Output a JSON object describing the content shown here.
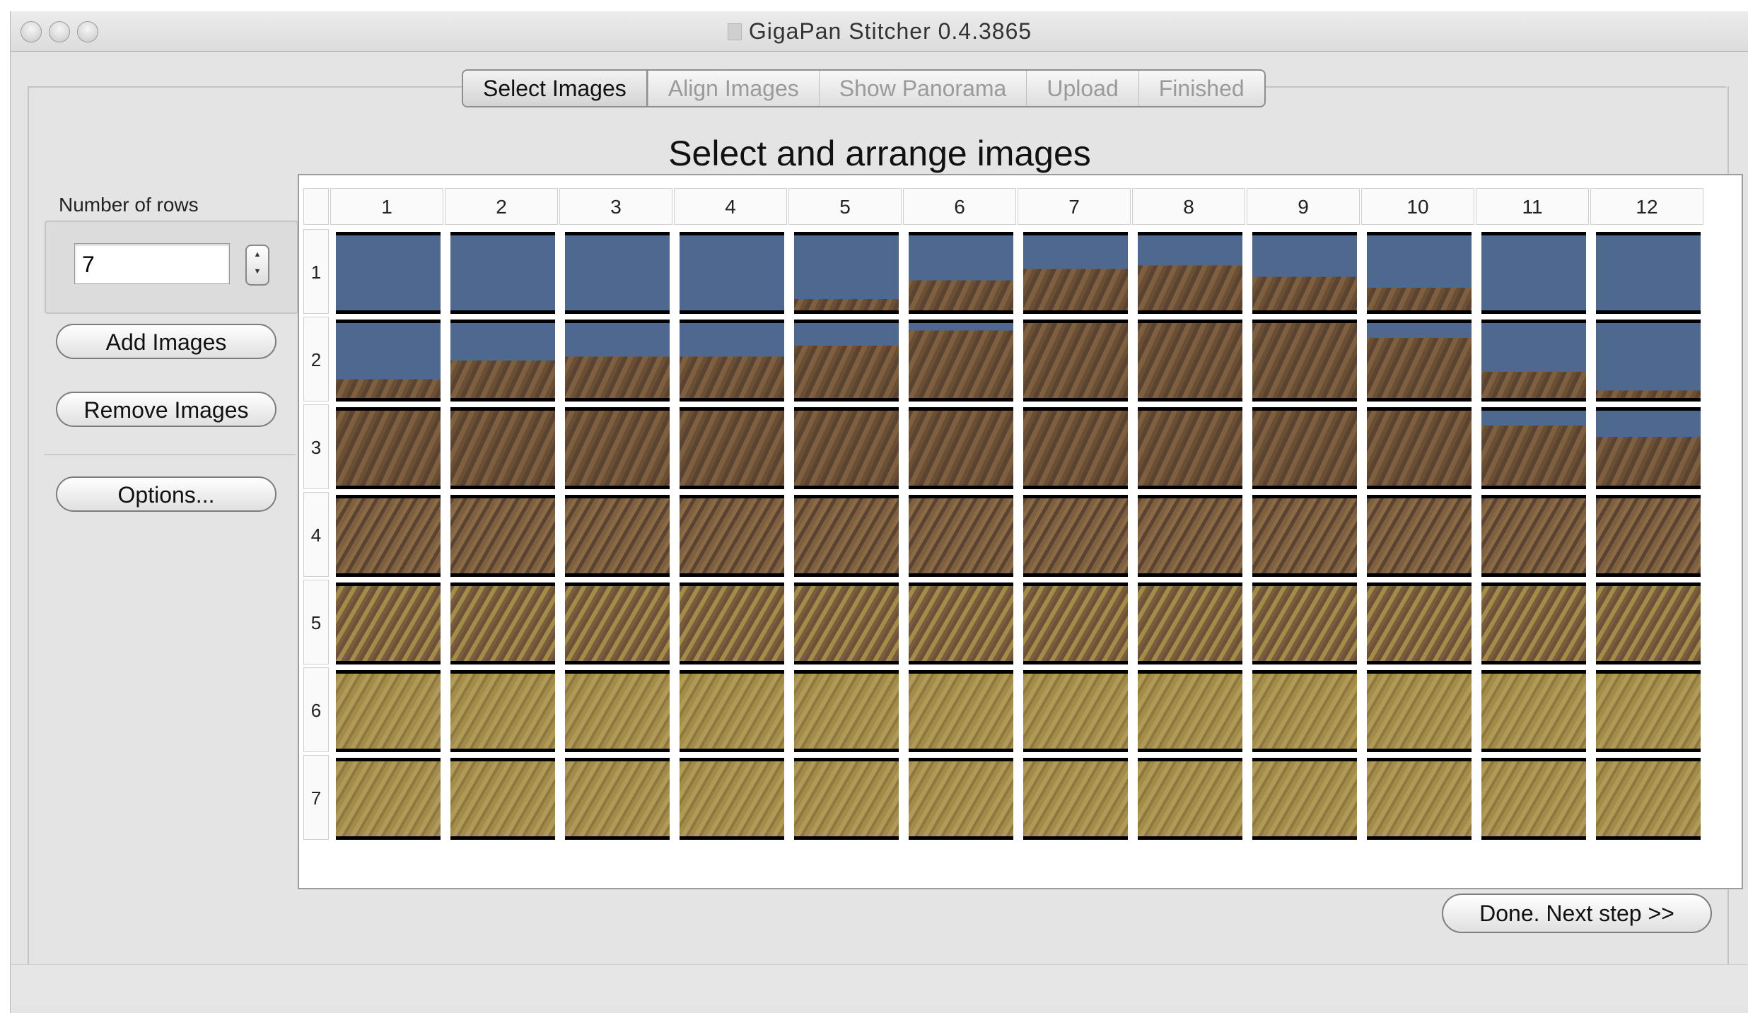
{
  "window": {
    "title": "GigaPan Stitcher 0.4.3865"
  },
  "tabs": [
    {
      "label": "Select Images",
      "active": true
    },
    {
      "label": "Align Images",
      "active": false
    },
    {
      "label": "Show Panorama",
      "active": false
    },
    {
      "label": "Upload",
      "active": false
    },
    {
      "label": "Finished",
      "active": false
    }
  ],
  "main": {
    "heading": "Select and arrange images"
  },
  "sidebar": {
    "rows_label": "Number of rows",
    "rows_value": "7",
    "add_images": "Add Images",
    "remove_images": "Remove Images",
    "options": "Options..."
  },
  "grid": {
    "columns": [
      "1",
      "2",
      "3",
      "4",
      "5",
      "6",
      "7",
      "8",
      "9",
      "10",
      "11",
      "12"
    ],
    "rows": [
      "1",
      "2",
      "3",
      "4",
      "5",
      "6",
      "7"
    ]
  },
  "footer": {
    "next_button": "Done.  Next step >>"
  },
  "colors": {
    "sky": "#4f6890",
    "rock_dark": "#5a4330",
    "rock_mid": "#7e6040",
    "grass": "#a38c4a",
    "grass_light": "#b09a58"
  }
}
